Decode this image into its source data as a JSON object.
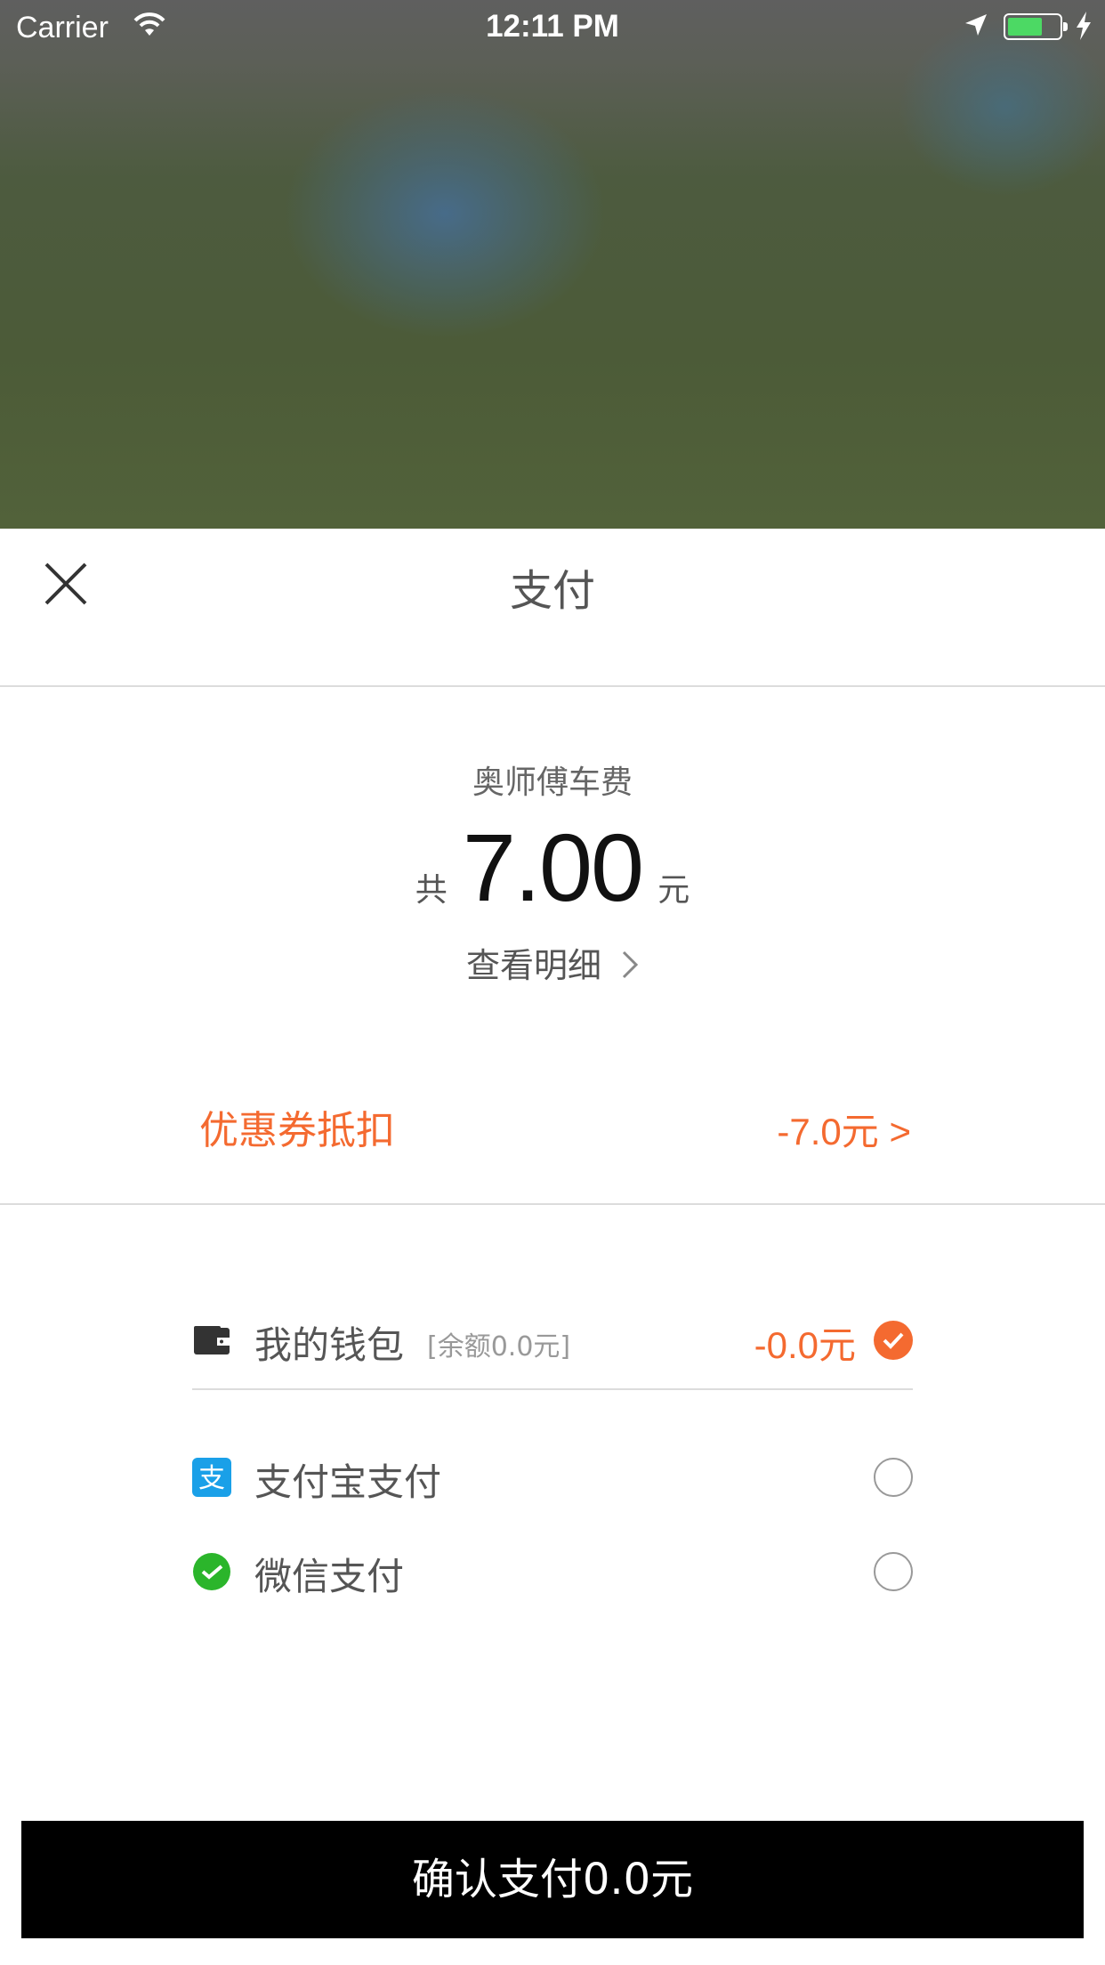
{
  "status_bar": {
    "carrier": "Carrier",
    "time": "12:11 PM"
  },
  "header": {
    "title": "支付"
  },
  "fare": {
    "service": "奥师傅车费",
    "prefix": "共",
    "amount": "7.00",
    "unit": "元",
    "detail_link": "查看明细"
  },
  "coupon": {
    "label": "优惠券抵扣",
    "value": "-7.0元 >"
  },
  "payment_methods": {
    "wallet": {
      "name": "我的钱包",
      "balance": "[余额0.0元]",
      "amount": "-0.0元"
    },
    "alipay": {
      "name": "支付宝支付"
    },
    "wechat": {
      "name": "微信支付"
    }
  },
  "confirm_button": "确认支付0.0元",
  "colors": {
    "accent": "#f46a30",
    "alipay": "#1aa0e8",
    "wechat": "#2bb52b",
    "button": "#000000"
  }
}
